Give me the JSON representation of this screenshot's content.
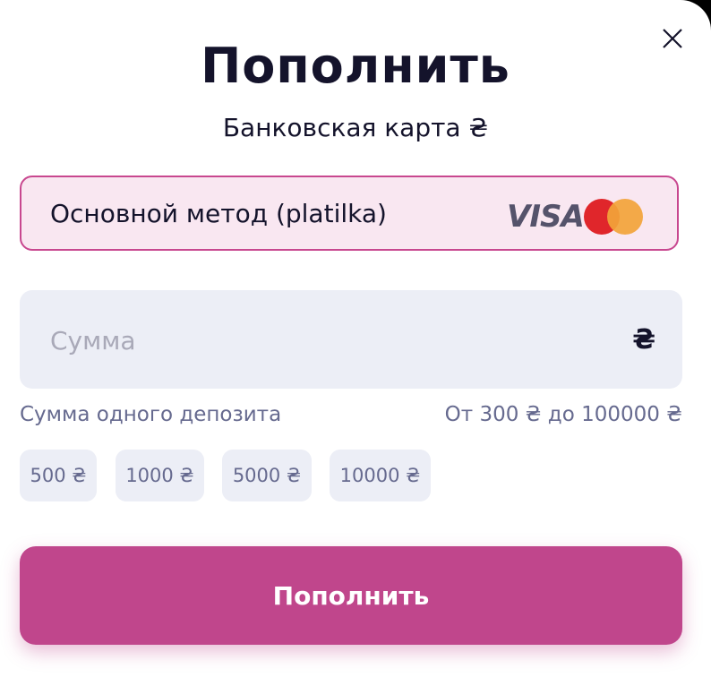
{
  "header": {
    "title": "Пополнить",
    "subtitle": "Банковская карта ₴",
    "close_icon": "close-icon"
  },
  "payment_method": {
    "label": "Основной метод (platilka)",
    "logos": {
      "visa_text": "VISA",
      "mastercard": "mastercard-icon"
    }
  },
  "amount": {
    "placeholder": "Сумма",
    "value": "",
    "currency": "₴"
  },
  "limits": {
    "label": "Сумма одного депозита",
    "range": "От 300 ₴ до 100000 ₴"
  },
  "presets": [
    "500 ₴",
    "1000 ₴",
    "5000 ₴",
    "10000 ₴"
  ],
  "submit_label": "Пополнить",
  "colors": {
    "accent": "#c0468c",
    "accent_light": "#f9e7f1",
    "title": "#14132b",
    "muted": "#666a8f",
    "field_bg": "#eceef6"
  }
}
